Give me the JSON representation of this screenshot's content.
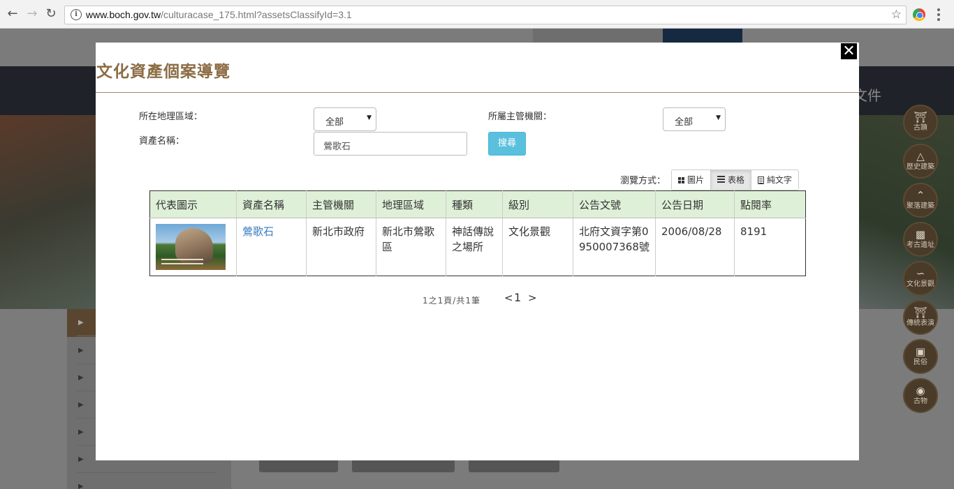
{
  "browser": {
    "url_domain": "www.boch.gov.tw",
    "url_path": "/culturacase_175.html?assetsClassifyId=3.1"
  },
  "background_page": {
    "nav_text": "文件"
  },
  "side_nav": [
    {
      "label": "古蹟",
      "icon": "temple-icon"
    },
    {
      "label": "歷史建築",
      "icon": "pyramid-icon"
    },
    {
      "label": "聚落建築",
      "icon": "roof-icon"
    },
    {
      "label": "考古遺址",
      "icon": "artifact-icon"
    },
    {
      "label": "文化景觀",
      "icon": "landscape-icon"
    },
    {
      "label": "傳統表演",
      "icon": "torii-icon"
    },
    {
      "label": "民俗",
      "icon": "lantern-icon"
    },
    {
      "label": "古物",
      "icon": "vase-icon"
    }
  ],
  "modal": {
    "title": "文化資產個案導覽",
    "close_label": "✕",
    "filters": {
      "region_label": "所在地理區域：",
      "region_value": "全部",
      "agency_label": "所屬主管機關：",
      "agency_value": "全部",
      "name_label": "資產名稱：",
      "name_value": "鶯歌石",
      "search_label": "搜尋"
    },
    "view": {
      "label": "瀏覽方式：",
      "options": [
        "圖片",
        "表格",
        "純文字"
      ],
      "active": "表格"
    },
    "table": {
      "headers": [
        "代表圖示",
        "資產名稱",
        "主管機關",
        "地理區域",
        "種類",
        "級別",
        "公告文號",
        "公告日期",
        "點閱率"
      ],
      "rows": [
        {
          "name": "鶯歌石",
          "agency": "新北市政府",
          "region": "新北市鶯歌區",
          "category": "神話傳說之場所",
          "level": "文化景觀",
          "notice_no": "北府文資字第0950007368號",
          "notice_date": "2006/08/28",
          "views": "8191"
        }
      ]
    },
    "pager": {
      "info": "1之1頁/共1筆",
      "prev": "<",
      "page": "1",
      "next": ">"
    }
  }
}
